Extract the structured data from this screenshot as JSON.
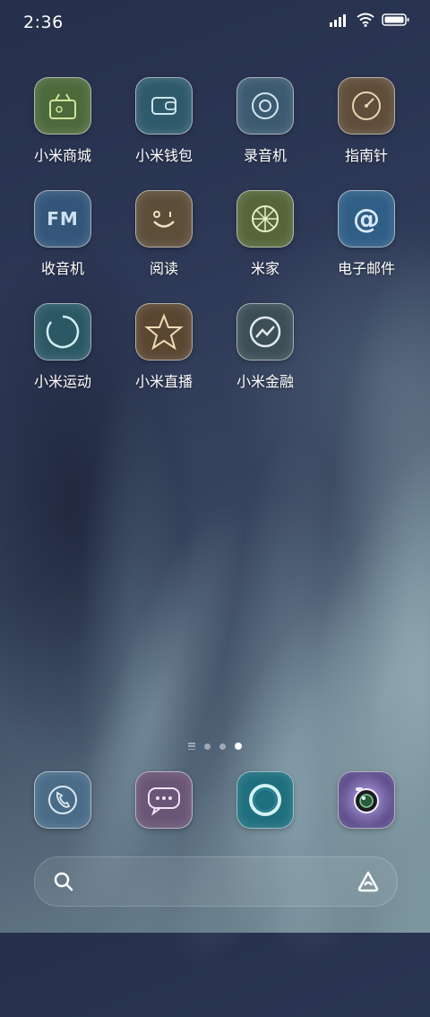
{
  "status_bar": {
    "time": "2:36"
  },
  "apps": [
    {
      "label": "小米商城",
      "icon": "mi-store-icon",
      "color": "#4d6a3c"
    },
    {
      "label": "小米钱包",
      "icon": "wallet-icon",
      "color": "#2f5a6c"
    },
    {
      "label": "录音机",
      "icon": "recorder-icon",
      "color": "#3c5a70"
    },
    {
      "label": "指南针",
      "icon": "compass-icon",
      "color": "#5f4e3a"
    },
    {
      "label": "收音机",
      "icon": "radio-fm-icon",
      "color": "#34567a",
      "glyph": "FM"
    },
    {
      "label": "阅读",
      "icon": "reader-smile-icon",
      "color": "#5d4e3a"
    },
    {
      "label": "米家",
      "icon": "mi-home-icon",
      "color": "#56663a"
    },
    {
      "label": "电子邮件",
      "icon": "email-at-icon",
      "color": "#2f5e86",
      "glyph": "@"
    },
    {
      "label": "小米运动",
      "icon": "mi-fit-icon",
      "color": "#2c5866"
    },
    {
      "label": "小米直播",
      "icon": "live-star-icon",
      "color": "#5a4732"
    },
    {
      "label": "小米金融",
      "icon": "finance-icon",
      "color": "#3d4e56"
    }
  ],
  "page_indicator": {
    "pages": 3,
    "current": 3
  },
  "dock": [
    {
      "name": "phone",
      "icon": "phone-icon",
      "color": "#4a6c88"
    },
    {
      "name": "messages",
      "icon": "message-icon",
      "color": "#6a5576"
    },
    {
      "name": "browser",
      "icon": "browser-ring-icon",
      "color": "#1f6f7e"
    },
    {
      "name": "camera",
      "icon": "camera-icon",
      "color": "#5a4a8a"
    }
  ]
}
